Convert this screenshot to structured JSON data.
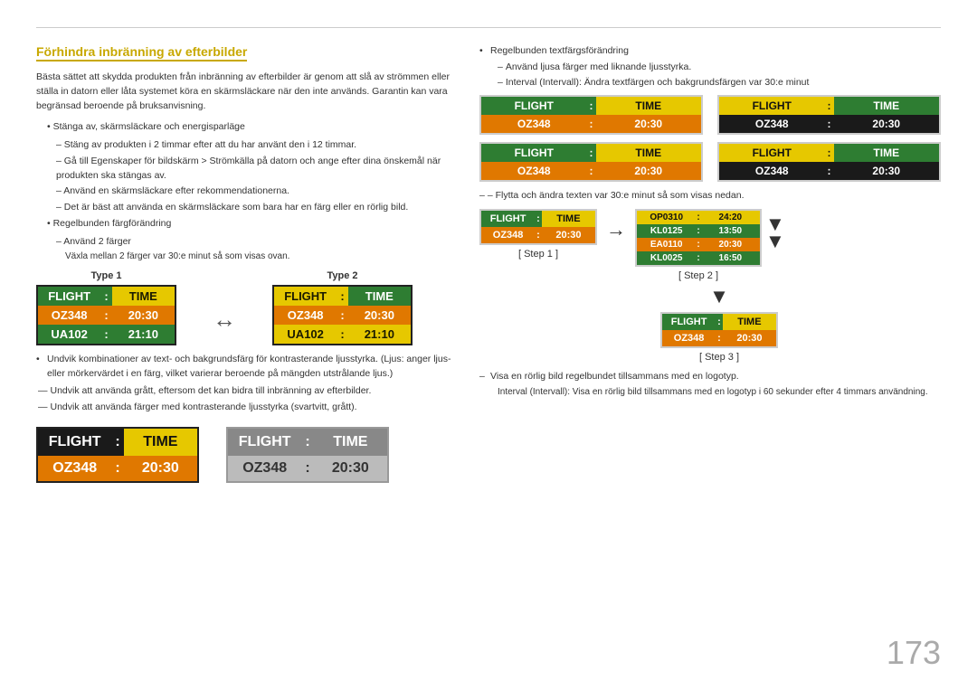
{
  "page": {
    "page_number": "173"
  },
  "section_title": "Förhindra inbränning av efterbilder",
  "intro_text": "Bästa sättet att skydda produkten från inbränning av efterbilder är genom att slå av strömmen eller ställa in datorn eller låta systemet köra en skärmsläckare när den inte används. Garantin kan vara begränsad beroende på bruksanvisning.",
  "bullets": [
    {
      "text": "Stänga av, skärmsläckare och energisparläge",
      "dashes": [
        "Stäng av produkten i 2 timmar efter att du har använt den i 12 timmar.",
        "Gå till Egenskaper för bildskärm > Strömkälla på datorn och ange efter dina önskemål när produkten ska stängas av.",
        "Använd en skärmsläckare efter rekommendationerna.",
        "Det är bäst att använda en skärmsläckare som bara har en färg eller en rörlig bild."
      ]
    },
    {
      "text": "Regelbunden färgförändring",
      "dashes": [
        "Använd 2 färger"
      ],
      "sub_note": "Växla mellan 2 färger var 30:e minut så som visas ovan."
    }
  ],
  "type1_label": "Type 1",
  "type2_label": "Type 2",
  "type1_board": {
    "header": [
      "FLIGHT",
      ":",
      "TIME"
    ],
    "row1": [
      "OZ348",
      ":",
      "20:30"
    ],
    "row2": [
      "UA102",
      ":",
      "21:10"
    ]
  },
  "type2_board": {
    "header": [
      "FLIGHT",
      ":",
      "TIME"
    ],
    "row1": [
      "OZ348",
      ":",
      "20:30"
    ],
    "row2": [
      "UA102",
      ":",
      "21:10"
    ]
  },
  "avoid_bullets": [
    "Undvik kombinationer av text- och bakgrundsfärg för kontrasterande ljusstyrka. (Ljus: anger ljus- eller mörkervärdet i en färg, vilket varierar beroende på mängden utstrålande ljus.)",
    "Undvik att använda grått, eftersom det kan bidra till inbränning av efterbilder.",
    "Undvik att använda färger med kontrasterande ljusstyrka (svartvitt, grått)."
  ],
  "bottom_board1": {
    "header": [
      "FLIGHT",
      ":",
      "TIME"
    ],
    "row1": [
      "OZ348",
      ":",
      "20:30"
    ],
    "style": "dark"
  },
  "bottom_board2": {
    "header": [
      "FLIGHT",
      ":",
      "TIME"
    ],
    "row1": [
      "OZ348",
      ":",
      "20:30"
    ],
    "style": "gray"
  },
  "right_col": {
    "bullet1": "Regelbunden textfärgsförändring",
    "dash1": "Använd ljusa färger med liknande ljusstyrka.",
    "dash2": "Interval (Intervall): Ändra textfärgen och bakgrundsfärgen var 30:e minut",
    "boards": [
      {
        "header": [
          "FLIGHT",
          ":",
          "TIME"
        ],
        "row": [
          "OZ348",
          ":",
          "20:30"
        ],
        "style": "green-yellow"
      },
      {
        "header": [
          "FLIGHT",
          ":",
          "TIME"
        ],
        "row": [
          "OZ348",
          ":",
          "20:30"
        ],
        "style": "yellow-green"
      },
      {
        "header": [
          "FLIGHT",
          ":",
          "TIME"
        ],
        "row": [
          "OZ348",
          ":",
          "20:30"
        ],
        "style": "green-yellow2"
      },
      {
        "header": [
          "FLIGHT",
          ":",
          "TIME"
        ],
        "row": [
          "OZ348",
          ":",
          "20:30"
        ],
        "style": "yellow-green2"
      }
    ],
    "move_note": "– Flytta och ändra texten var 30:e minut så som visas nedan.",
    "step1_label": "[ Step 1 ]",
    "step2_label": "[ Step 2 ]",
    "step3_label": "[ Step 3 ]",
    "step1_board": {
      "header": [
        "FLIGHT",
        ":",
        "TIME"
      ],
      "row": [
        "OZ348",
        ":",
        "20:30"
      ]
    },
    "step2_board": {
      "rows": [
        [
          "OP0310",
          ":",
          "24:20"
        ],
        [
          "KL0125",
          ":",
          "13:50"
        ],
        [
          "EA0110",
          ":",
          "20:30"
        ],
        [
          "KL0025",
          ":",
          "16:50"
        ]
      ]
    },
    "step3_board": {
      "header": [
        "FLIGHT",
        ":",
        "TIME"
      ],
      "row": [
        "OZ348",
        ":",
        "20:30"
      ]
    },
    "final_bullets": [
      "Visa en rörlig bild regelbundet tillsammans med en logotyp.",
      "Interval (Intervall): Visa en rörlig bild tillsammans med en logotyp i 60 sekunder efter 4 timmars användning."
    ]
  }
}
